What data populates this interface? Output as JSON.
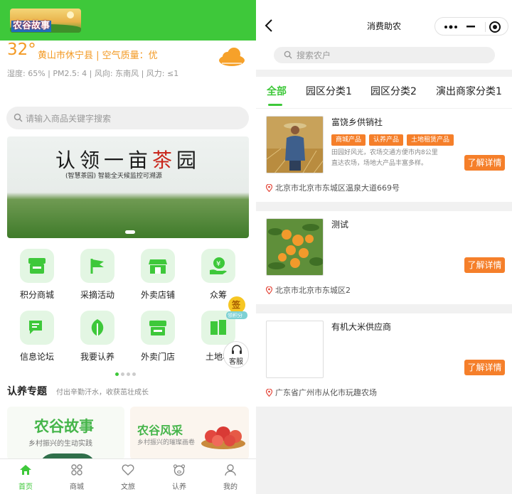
{
  "left": {
    "logo_text": "农谷故事",
    "weather": {
      "temperature": "32°",
      "location_line": "黄山市休宁县  |  空气质量：优",
      "details_line": "湿度: 65%   |   PM2.5: 4   |   风向: 东南风   |   风力: ≤1",
      "icon": "cloud-icon"
    },
    "search": {
      "placeholder": "请输入商品关键字搜索"
    },
    "banner": {
      "title_part1": "认领一亩",
      "title_accent": "茶",
      "title_part2": "园",
      "subtitle": "(智慧茶园) 智能全天候监控可溯源"
    },
    "grid_items": [
      {
        "label": "积分商城",
        "icon": "shop-icon"
      },
      {
        "label": "采摘活动",
        "icon": "flag-icon"
      },
      {
        "label": "外卖店铺",
        "icon": "store-icon"
      },
      {
        "label": "众筹",
        "icon": "money-hand-icon"
      },
      {
        "label": "信息论坛",
        "icon": "chat-icon"
      },
      {
        "label": "我要认养",
        "icon": "leaf-icon"
      },
      {
        "label": "外卖门店",
        "icon": "storefront-icon"
      },
      {
        "label": "土地租",
        "icon": "land-icon"
      }
    ],
    "float_sign": {
      "label": "签",
      "sub": "领积分"
    },
    "service_button": "客服",
    "section": {
      "title": "认养专题",
      "subtitle": "付出辛勤汗水，收获茁壮成长"
    },
    "cards": [
      {
        "title": "农谷故事",
        "subtitle": "乡村振兴的生动实践"
      },
      {
        "title": "农谷风采",
        "subtitle": "乡村振兴的璀璨画卷"
      }
    ],
    "tabs": [
      {
        "label": "首页",
        "icon": "home-icon",
        "active": true
      },
      {
        "label": "商城",
        "icon": "grid-icon",
        "active": false
      },
      {
        "label": "文旅",
        "icon": "heart-icon",
        "active": false
      },
      {
        "label": "认养",
        "icon": "pig-icon",
        "active": false
      },
      {
        "label": "我的",
        "icon": "user-icon",
        "active": false
      }
    ],
    "accent_color": "#3ec83a"
  },
  "right": {
    "title": "消费助农",
    "search": {
      "placeholder": "搜索农户"
    },
    "categories": [
      "全部",
      "园区分类1",
      "园区分类2",
      "演出商家分类1"
    ],
    "active_category": "全部",
    "items": [
      {
        "name": "富饶乡供销社",
        "tags": [
          "商城产品",
          "认养产品",
          "土地租赁产品"
        ],
        "desc_line1": "田园好风光，农场交通方便市内8公里",
        "desc_line2": "直达农场，场地大产品丰富多样。",
        "address": "北京市北京市东城区温泉大道669号",
        "button": "了解详情",
        "thumb": "farmer-photo"
      },
      {
        "name": "测试",
        "tags": [],
        "desc_line1": "",
        "desc_line2": "",
        "address": "北京市北京市东城区2",
        "button": "了解详情",
        "thumb": "orange-photo"
      },
      {
        "name": "有机大米供应商",
        "tags": [],
        "desc_line1": "",
        "desc_line2": "",
        "address": "广东省广州市从化市玩趣农场",
        "button": "了解详情",
        "thumb": "empty"
      }
    ],
    "button_color": "#f57f2a"
  }
}
